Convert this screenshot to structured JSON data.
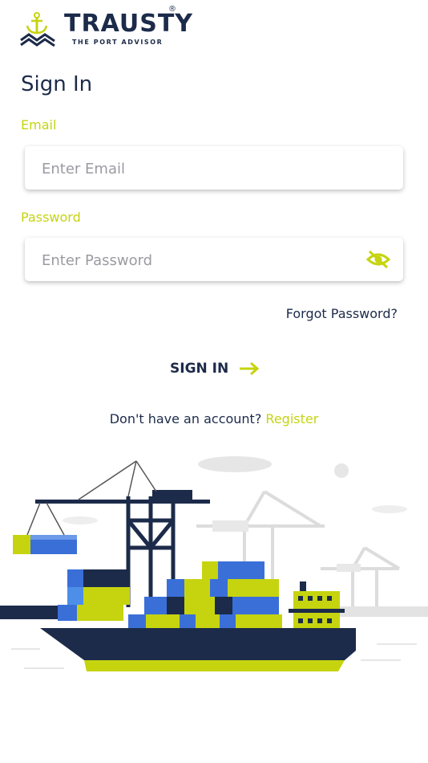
{
  "brand": {
    "name": "TRAUSTY",
    "tagline": "THE PORT ADVISOR",
    "registered": "®"
  },
  "page": {
    "title": "Sign In"
  },
  "form": {
    "email_label": "Email",
    "email_placeholder": "Enter Email",
    "password_label": "Password",
    "password_placeholder": "Enter Password",
    "forgot_label": "Forgot Password?",
    "submit_label": "SIGN IN"
  },
  "footer": {
    "prompt": "Don't have an account?",
    "register_label": "Register"
  },
  "colors": {
    "accent": "#c6d410",
    "navy": "#1c2b4a",
    "blue": "#3a6fd8"
  },
  "icons": {
    "logo": "anchor-wave-icon",
    "password_toggle": "eye-off-icon",
    "submit": "arrow-right-icon",
    "illustration": "cargo-ship-illustration"
  }
}
